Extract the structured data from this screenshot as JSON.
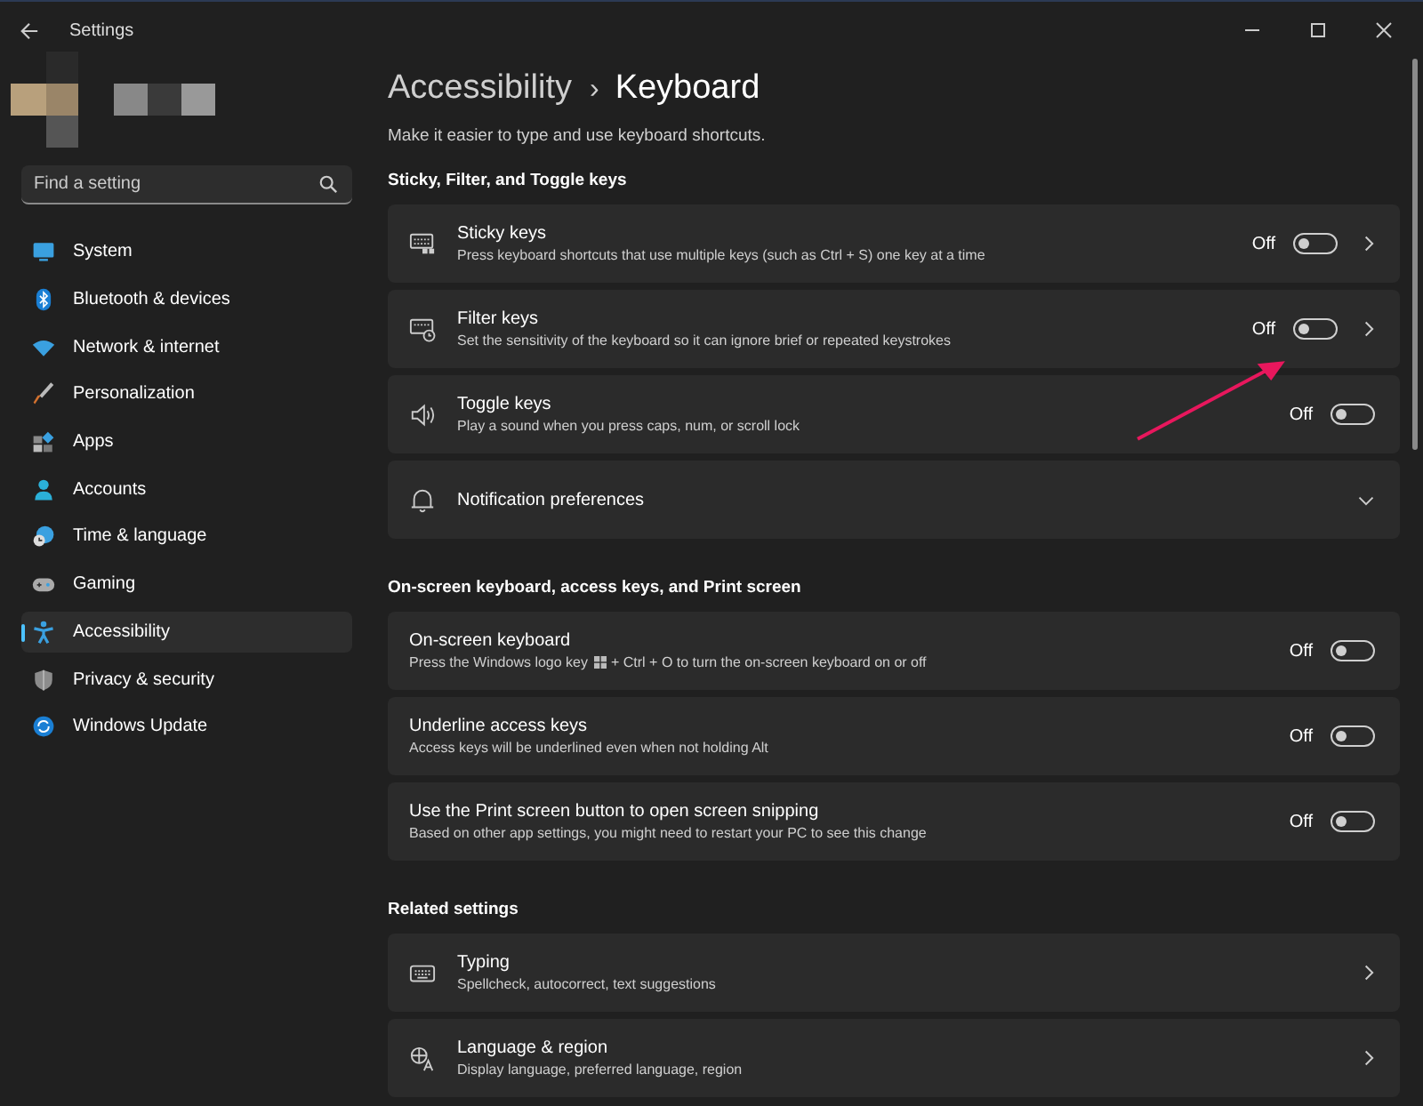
{
  "window": {
    "title": "Settings"
  },
  "search": {
    "placeholder": "Find a setting"
  },
  "sidebar": {
    "items": [
      {
        "label": "System",
        "selected": false
      },
      {
        "label": "Bluetooth & devices",
        "selected": false
      },
      {
        "label": "Network & internet",
        "selected": false
      },
      {
        "label": "Personalization",
        "selected": false
      },
      {
        "label": "Apps",
        "selected": false
      },
      {
        "label": "Accounts",
        "selected": false
      },
      {
        "label": "Time & language",
        "selected": false
      },
      {
        "label": "Gaming",
        "selected": false
      },
      {
        "label": "Accessibility",
        "selected": true
      },
      {
        "label": "Privacy & security",
        "selected": false
      },
      {
        "label": "Windows Update",
        "selected": false
      }
    ]
  },
  "breadcrumb": {
    "parent": "Accessibility",
    "separator": "›",
    "current": "Keyboard"
  },
  "subtitle": "Make it easier to type and use keyboard shortcuts.",
  "sections": [
    {
      "heading": "Sticky, Filter, and Toggle keys",
      "rows": [
        {
          "kind": "link",
          "title": "Sticky keys",
          "description": [
            "Press keyboard shortcuts that use multiple keys (such as Ctrl + S) one key at a time"
          ],
          "toggle": {
            "label": "Off",
            "on": false
          }
        },
        {
          "kind": "link",
          "title": "Filter keys",
          "description": [
            "Set the sensitivity of the keyboard so it can ignore brief or repeated keystrokes"
          ],
          "toggle": {
            "label": "Off",
            "on": false
          }
        },
        {
          "kind": "plain",
          "title": "Toggle keys",
          "description": [
            "Play a sound when you press caps, num, or scroll lock"
          ],
          "toggle": {
            "label": "Off",
            "on": false
          }
        },
        {
          "kind": "expander",
          "title": "Notification preferences"
        }
      ]
    },
    {
      "heading": "On-screen keyboard, access keys, and Print screen",
      "rows": [
        {
          "kind": "plain",
          "title": "On-screen keyboard",
          "description": [
            "Press the Windows logo key",
            "+ Ctrl + O to turn the on-screen keyboard on or off"
          ],
          "toggle": {
            "label": "Off",
            "on": false
          }
        },
        {
          "kind": "plain",
          "title": "Underline access keys",
          "description": [
            "Access keys will be underlined even when not holding Alt"
          ],
          "toggle": {
            "label": "Off",
            "on": false
          }
        },
        {
          "kind": "plain",
          "title": "Use the Print screen button to open screen snipping",
          "description": [
            "Based on other app settings, you might need to restart your PC to see this change"
          ],
          "toggle": {
            "label": "Off",
            "on": false
          }
        }
      ]
    },
    {
      "heading": "Related settings",
      "rows": [
        {
          "kind": "link",
          "title": "Typing",
          "description": [
            "Spellcheck, autocorrect, text suggestions"
          ]
        },
        {
          "kind": "link",
          "title": "Language & region",
          "description": [
            "Display language, preferred language, region"
          ]
        }
      ]
    }
  ]
}
